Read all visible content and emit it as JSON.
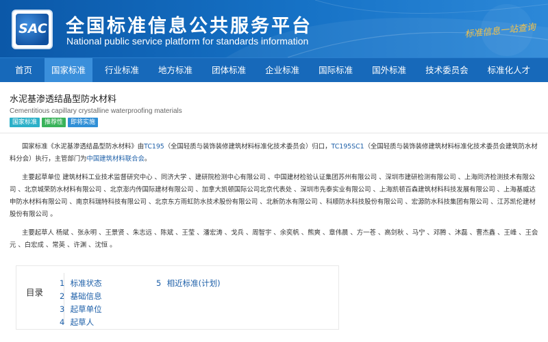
{
  "header": {
    "logo_text": "SAC",
    "title_cn": "全国标准信息公共服务平台",
    "title_en": "National public service platform  for standards information",
    "slogan": "标准信息一站查询"
  },
  "nav": {
    "items": [
      {
        "label": "首页",
        "active": false
      },
      {
        "label": "国家标准",
        "active": true
      },
      {
        "label": "行业标准",
        "active": false
      },
      {
        "label": "地方标准",
        "active": false
      },
      {
        "label": "团体标准",
        "active": false
      },
      {
        "label": "企业标准",
        "active": false
      },
      {
        "label": "国际标准",
        "active": false
      },
      {
        "label": "国外标准",
        "active": false
      },
      {
        "label": "技术委员会",
        "active": false
      },
      {
        "label": "标准化人才",
        "active": false
      }
    ]
  },
  "standard": {
    "title_cn": "水泥基渗透结晶型防水材料",
    "title_en": "Cementitious capillary crystalline waterproofing materials",
    "tags": [
      "国家标准",
      "推荐性",
      "即将实施"
    ]
  },
  "intro": {
    "t1": "国家标准《水泥基渗透结晶型防水材料》由",
    "tc": "TC195",
    "t2": "（全国轻质与装饰装修建筑材料标准化技术委员会）归口，",
    "sc": "TC195SC1",
    "t3": "（全国轻质与装饰装修建筑材料标准化技术委员会建筑防水材料分会）执行，主管部门为",
    "dept": "中国建筑材料联合会",
    "t4": "。"
  },
  "drafting_units": "主要起草单位 建筑材料工业技术监督研究中心 、同济大学 、建研院检测中心有限公司 、中国建材检验认证集团苏州有限公司 、深圳市建研检测有限公司 、上海同济检测技术有限公司 、北京城荣防水材料有限公司 、北京澎内传国际建材有限公司 、加拿大凯顿国际公司北京代表处 、深圳市先泰实业有限公司 、上海凯顿百森建筑材料科技发展有限公司 、上海基威达申防水材料有限公司 、南京科瑞特科技有限公司 、北京东方雨虹防水技术股份有限公司 、北新防水有限公司 、科顺防水科技股份有限公司 、宏源防水科技集团有限公司 、江苏凯伦建材股份有限公司 。",
  "drafters": "主要起草人 杨斌 、张永明 、王景贤 、朱志远 、陈斌 、王莹 、潘宏涛 、戈兵 、周智宇 、余奕帆 、熊爽 、章伟晨 、方一苍 、高剑秋 、马宁 、邓腾 、沐磊 、曹杰鑫 、王峰 、王会元 、白宏成 、常英 、许渊 、沈恒 。",
  "toc": {
    "label": "目录",
    "col1": [
      {
        "num": "1",
        "label": "标准状态"
      },
      {
        "num": "2",
        "label": "基础信息"
      },
      {
        "num": "3",
        "label": "起草单位"
      },
      {
        "num": "4",
        "label": "起草人"
      }
    ],
    "col2": [
      {
        "num": "5",
        "label": "相近标准(计划)"
      }
    ]
  }
}
